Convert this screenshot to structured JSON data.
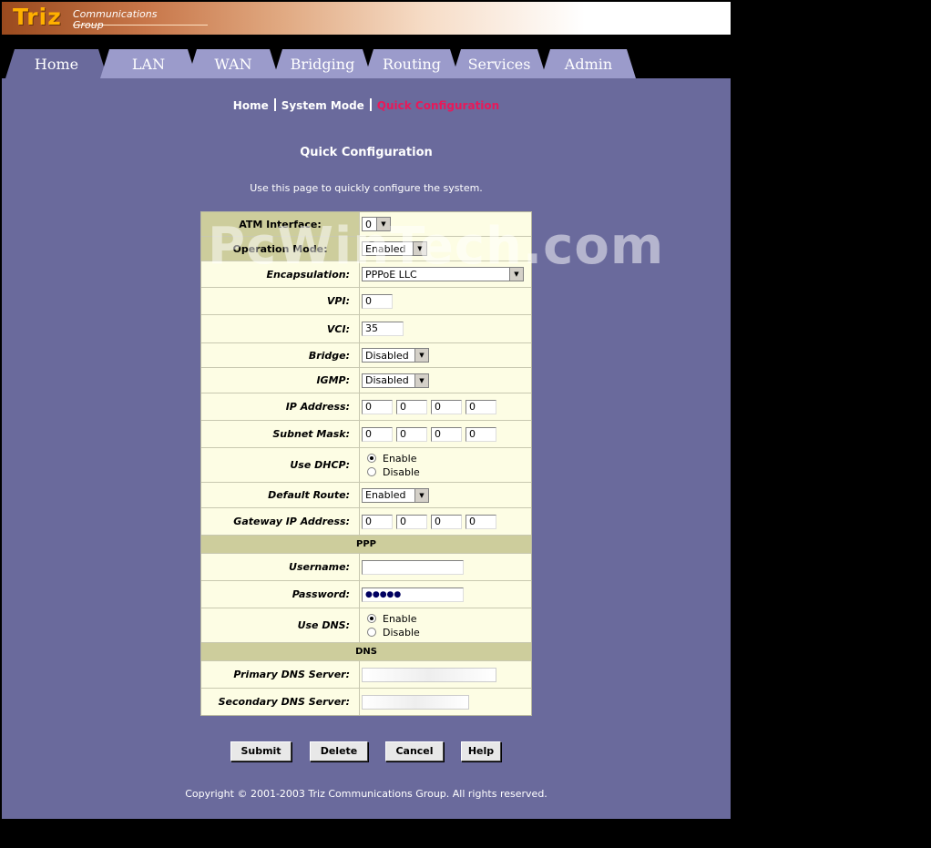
{
  "banner": {
    "logo": "Triz",
    "sub_line1": "Communications",
    "sub_line2": "Group"
  },
  "tabs": [
    {
      "label": "Home",
      "active": true
    },
    {
      "label": "LAN"
    },
    {
      "label": "WAN"
    },
    {
      "label": "Bridging"
    },
    {
      "label": "Routing"
    },
    {
      "label": "Services"
    },
    {
      "label": "Admin"
    }
  ],
  "breadcrumb": {
    "items": [
      "Home",
      "System Mode",
      "Quick Configuration"
    ],
    "current_color": "#e8195a"
  },
  "page": {
    "title": "Quick Configuration",
    "description": "Use this page to quickly configure the system."
  },
  "form": {
    "atm_interface": {
      "label": "ATM Interface:",
      "value": "0"
    },
    "operation_mode": {
      "label": "Operation Mode:",
      "value": "Enabled"
    },
    "encapsulation": {
      "label": "Encapsulation:",
      "value": "PPPoE LLC"
    },
    "vpi": {
      "label": "VPI:",
      "value": "0"
    },
    "vci": {
      "label": "VCI:",
      "value": "35"
    },
    "bridge": {
      "label": "Bridge:",
      "value": "Disabled"
    },
    "igmp": {
      "label": "IGMP:",
      "value": "Disabled"
    },
    "ip_address": {
      "label": "IP Address:",
      "octets": [
        "0",
        "0",
        "0",
        "0"
      ]
    },
    "subnet_mask": {
      "label": "Subnet Mask:",
      "octets": [
        "0",
        "0",
        "0",
        "0"
      ]
    },
    "use_dhcp": {
      "label": "Use DHCP:",
      "options": [
        "Enable",
        "Disable"
      ],
      "selected": "Enable"
    },
    "default_route": {
      "label": "Default Route:",
      "value": "Enabled"
    },
    "gateway_ip": {
      "label": "Gateway IP Address:",
      "octets": [
        "0",
        "0",
        "0",
        "0"
      ]
    },
    "ppp_section": "PPP",
    "username": {
      "label": "Username:",
      "value": ""
    },
    "password": {
      "label": "Password:",
      "value": "●●●●●"
    },
    "use_dns": {
      "label": "Use DNS:",
      "options": [
        "Enable",
        "Disable"
      ],
      "selected": "Enable"
    },
    "dns_section": "DNS",
    "primary_dns": {
      "label": "Primary DNS Server:"
    },
    "secondary_dns": {
      "label": "Secondary DNS Server:"
    }
  },
  "buttons": {
    "submit": "Submit",
    "delete": "Delete",
    "cancel": "Cancel",
    "help": "Help"
  },
  "footer": {
    "copyright": "Copyright © 2001-2003 Triz Communications Group. All rights reserved."
  },
  "watermark": "PcWinTech.com",
  "colors": {
    "page_bg": "#6a6a9c",
    "tab_bg": "#9b9bcb",
    "form_bg": "#fdfde4",
    "highlight_label": "#cdcd9c"
  }
}
